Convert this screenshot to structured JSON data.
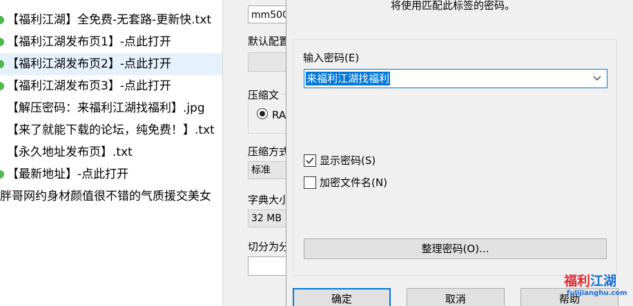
{
  "file_list": [
    {
      "name": "【福利江湖】全免费-无套路-更新快.txt",
      "icon": "file-green-icon",
      "selected": false
    },
    {
      "name": "【福利江湖发布页1】-点此打开",
      "icon": "shortcut-green-icon",
      "selected": false
    },
    {
      "name": "【福利江湖发布页2】-点此打开",
      "icon": "shortcut-green-icon",
      "selected": true
    },
    {
      "name": "【福利江湖发布页3】-点此打开",
      "icon": "shortcut-green-icon",
      "selected": false
    },
    {
      "name": "【解压密码：来福利江湖找福利】.jpg",
      "icon": "image-file-icon",
      "selected": false
    },
    {
      "name": "【来了就能下载的论坛，纯免费！】.txt",
      "icon": "text-file-icon",
      "selected": false
    },
    {
      "name": "【永久地址发布页】.txt",
      "icon": "text-file-icon",
      "selected": false
    },
    {
      "name": "【最新地址】-点此打开",
      "icon": "shortcut-green-icon",
      "selected": false
    },
    {
      "name": "胖哥网约身材颜值很不错的气质援交美女",
      "icon": "folder-icon",
      "selected": false
    }
  ],
  "archive_dialog": {
    "archive_name_value": "mm500",
    "default_config_label": "默认配置",
    "format_group_label": "压缩文",
    "format_radio_label": "RA",
    "method_label": "压缩方式",
    "method_value": "标准",
    "dict_label": "字典大小",
    "dict_value": "32 MB",
    "split_label": "切分为分卷"
  },
  "password_dialog": {
    "note": "将使用匹配此标签的密码。",
    "password_label": "输入密码(E)",
    "password_value": "来福利江湖找福利",
    "show_password_label": "显示密码(S)",
    "show_password_checked": true,
    "encrypt_names_label": "加密文件名(N)",
    "encrypt_names_checked": false,
    "organize_button": "整理密码(O)...",
    "ok_button": "确定",
    "cancel_button": "取消",
    "help_button": "帮助"
  },
  "watermark": {
    "text_part1": "福利",
    "text_part2": "江湖",
    "domain": "fulijianghu.com"
  },
  "colors": {
    "accent": "#0078d7",
    "selection_row": "#e5f1fb",
    "dialog_bg": "#f0f0f0",
    "green_icon": "#4fb84a"
  }
}
